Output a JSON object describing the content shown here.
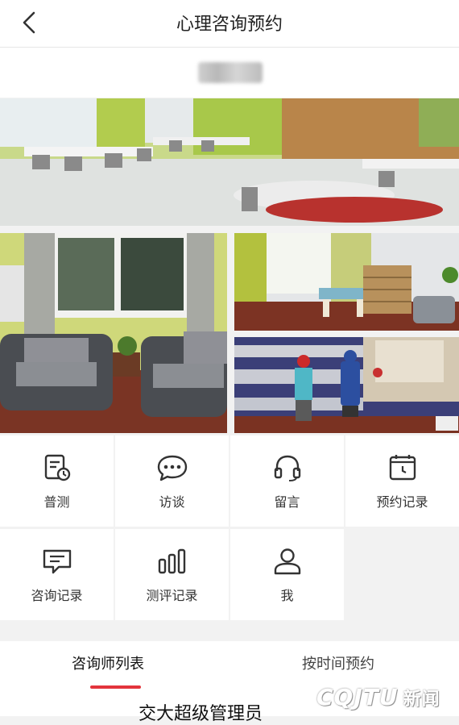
{
  "header": {
    "title": "心理咨询预约",
    "back_icon": "chevron-left-icon"
  },
  "menu": [
    {
      "label": "普测",
      "icon": "survey-icon"
    },
    {
      "label": "访谈",
      "icon": "chat-bubble-icon"
    },
    {
      "label": "留言",
      "icon": "headset-icon"
    },
    {
      "label": "预约记录",
      "icon": "calendar-clock-icon"
    },
    {
      "label": "咨询记录",
      "icon": "message-icon"
    },
    {
      "label": "测评记录",
      "icon": "bar-chart-icon"
    },
    {
      "label": "我",
      "icon": "user-icon"
    }
  ],
  "tabs": {
    "counselor_list": "咨询师列表",
    "time_booking": "按时间预约"
  },
  "list": {
    "first_item_name": "交大超级管理员"
  },
  "watermark": {
    "latin": "CQJTU",
    "chinese": "新闻"
  },
  "colors": {
    "accent": "#e3343c"
  }
}
